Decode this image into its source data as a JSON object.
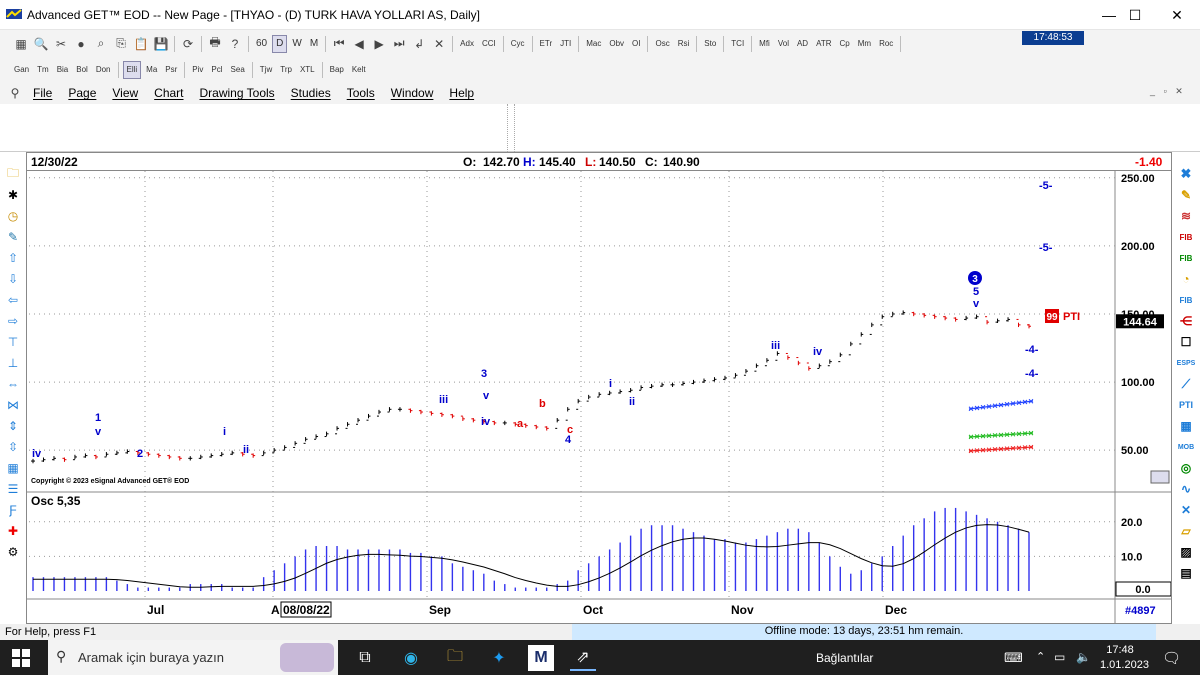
{
  "window": {
    "title": "Advanced GET™ EOD  --  New Page - [THYAO - (D) TURK HAVA YOLLARI AS, Daily]",
    "minimize": "—",
    "maximize": "☐",
    "close": "✕"
  },
  "toolbar1": {
    "interval": "60",
    "d_label": "D",
    "w_label": "W",
    "m_label": "M",
    "studies": [
      "Adx",
      "CCI",
      "Cyc",
      "ETr",
      "JTI",
      "Mac",
      "Obv",
      "OI",
      "Osc",
      "Rsi",
      "Sto",
      "TCI",
      "Mfi",
      "Vol",
      "AD",
      "ATR",
      "Cp",
      "Mm",
      "Roc"
    ],
    "clock": "17:48:53"
  },
  "toolbar2": {
    "items": [
      "Gan",
      "Tm",
      "Bia",
      "Bol",
      "Don",
      "Elli",
      "Ma",
      "Psr",
      "Piv",
      "Pcl",
      "Sea",
      "Tjw",
      "Trp",
      "XTL",
      "Bap",
      "Kelt"
    ],
    "selected": "Elli"
  },
  "menu": [
    "File",
    "Page",
    "View",
    "Chart",
    "Drawing Tools",
    "Studies",
    "Tools",
    "Window",
    "Help"
  ],
  "chart": {
    "date": "12/30/22",
    "open_label": "O:",
    "open": "142.70",
    "high_label": "H:",
    "high": "145.40",
    "low_label": "L:",
    "low": "140.50",
    "close_label": "C:",
    "close": "140.90",
    "change": "-1.40",
    "copyright": "Copyright © 2023 eSignal Advanced GET® EOD",
    "last_price": "144.64",
    "pti_value": "99",
    "pti_label": "PTI",
    "bar_count": "#4897",
    "osc_label": "Osc 5,35",
    "osc_last": "0.0",
    "price_ticks": [
      "250.00",
      "200.00",
      "150.00",
      "100.00",
      "50.00"
    ],
    "osc_ticks": [
      "20.0",
      "10.0"
    ],
    "months": [
      "Jul",
      "A",
      "08/08/22",
      "Sep",
      "Oct",
      "Nov",
      "Dec"
    ],
    "wave_labels": {
      "iv_left": "iv",
      "one": "1",
      "v1": "v",
      "two": "2",
      "i_a": "i",
      "ii_a": "ii",
      "iii_a": "iii",
      "three": "3",
      "v3": "v",
      "iv_b": "iv",
      "a": "a",
      "b": "b",
      "c": "c",
      "four": "4",
      "i_b": "i",
      "ii_b": "ii",
      "iii_b": "iii",
      "iv_c": "iv",
      "circle3": "3",
      "five": "5",
      "v5": "v",
      "t5a": "-5-",
      "t5b": "-5-",
      "t4a": "-4-",
      "t4b": "-4-"
    },
    "colors": {
      "up_bar": "#000000",
      "down_bar": "#e00000",
      "wave_blue": "#0000cc",
      "wave_red": "#dd0000",
      "osc_bar": "#3333ee",
      "price_badge": "#000000",
      "pti_badge": "#e00000"
    }
  },
  "chart_data": {
    "type": "bar",
    "title": "THYAO - (D) TURK HAVA YOLLARI AS, Daily",
    "price_range": [
      20,
      255
    ],
    "ohlc_last": {
      "open": 142.7,
      "high": 145.4,
      "low": 140.5,
      "close": 140.9
    },
    "closes": [
      42,
      43,
      44,
      43,
      45,
      46,
      45,
      47,
      48,
      49,
      48,
      47,
      46,
      45,
      44,
      44,
      45,
      46,
      47,
      48,
      47,
      46,
      48,
      50,
      52,
      55,
      58,
      60,
      62,
      66,
      69,
      72,
      75,
      78,
      80,
      80,
      79,
      78,
      77,
      76,
      75,
      73,
      72,
      71,
      70,
      70,
      69,
      68,
      67,
      66,
      72,
      80,
      86,
      89,
      91,
      92,
      93,
      94,
      96,
      97,
      98,
      98,
      99,
      100,
      101,
      102,
      103,
      105,
      108,
      112,
      116,
      121,
      118,
      114,
      110,
      112,
      115,
      120,
      128,
      135,
      142,
      148,
      150,
      151,
      150,
      149,
      148,
      147,
      146,
      147,
      148,
      144,
      145,
      146,
      142,
      141
    ],
    "oscillator": {
      "name": "Osc 5,35",
      "range": [
        0,
        26
      ],
      "values": [
        4,
        4,
        4,
        4,
        4,
        4,
        4,
        4,
        3,
        2,
        1,
        1,
        1,
        1,
        1,
        2,
        2,
        2,
        2,
        1,
        1,
        1,
        4,
        6,
        8,
        10,
        12,
        13,
        13,
        13,
        12,
        12,
        12,
        12,
        12,
        12,
        11,
        11,
        10,
        10,
        8,
        7,
        6,
        5,
        3,
        2,
        1,
        1,
        1,
        1,
        2,
        3,
        6,
        8,
        10,
        12,
        14,
        16,
        18,
        19,
        19,
        19,
        18,
        17,
        16,
        15,
        15,
        14,
        14,
        15,
        16,
        17,
        18,
        18,
        17,
        14,
        10,
        7,
        5,
        6,
        8,
        10,
        13,
        16,
        19,
        21,
        23,
        24,
        24,
        23,
        22,
        21,
        20,
        19,
        18,
        17
      ]
    },
    "osc_ylim": [
      0,
      26
    ]
  },
  "status": {
    "help": "For Help, press F1",
    "offline": "Offline mode: 13 days, 23:51 hm remain."
  },
  "taskbar": {
    "search_placeholder": "Aramak için buraya yazın",
    "connections": "Bağlantılar",
    "time": "17:48",
    "date": "1.01.2023"
  }
}
